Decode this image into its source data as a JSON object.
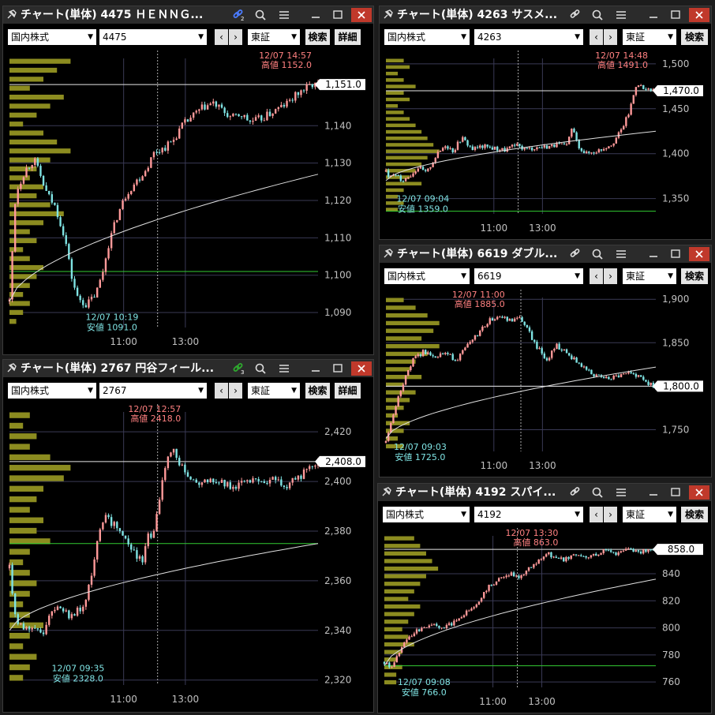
{
  "windows": [
    {
      "id": "w1",
      "title": "チャート(単体) 4475 ＨＥＮＮＧ...",
      "link_icon_color": "#4a7bff",
      "link_group": "2",
      "market_label": "国内株式",
      "code": "4475",
      "exchange": "東証",
      "search_label": "検索",
      "detail_label": "詳細",
      "chart_data": {
        "type": "candlestick",
        "ylim": [
          1086,
          1158
        ],
        "y_ticks": [
          "1,140",
          "1,130",
          "1,120",
          "1,110",
          "1,100",
          "1,090"
        ],
        "y_tick_values": [
          1140,
          1130,
          1120,
          1110,
          1100,
          1090
        ],
        "x_ticks": [
          "11:00",
          "13:00"
        ],
        "x_tick_positions": [
          0.37,
          0.57
        ],
        "lunch_break_position": 0.48,
        "current_price": 1151.0,
        "current_price_label": "1,151.0",
        "high": {
          "time": "12/07 14:57",
          "label": "高値 1152.0",
          "value": 1152.0,
          "position": 0.97
        },
        "low": {
          "time": "12/07 10:19",
          "label": "安値 1091.0",
          "value": 1091.0,
          "position": 0.23
        },
        "green_line": 1101,
        "vwap_start": 1093,
        "vwap_end": 1127,
        "path": [
          [
            0,
            1093
          ],
          [
            0.02,
            1122
          ],
          [
            0.05,
            1128
          ],
          [
            0.08,
            1131
          ],
          [
            0.12,
            1122
          ],
          [
            0.15,
            1118
          ],
          [
            0.18,
            1110
          ],
          [
            0.2,
            1100
          ],
          [
            0.22,
            1094
          ],
          [
            0.25,
            1092
          ],
          [
            0.28,
            1095
          ],
          [
            0.3,
            1100
          ],
          [
            0.32,
            1108
          ],
          [
            0.35,
            1116
          ],
          [
            0.38,
            1122
          ],
          [
            0.41,
            1125
          ],
          [
            0.44,
            1128
          ],
          [
            0.47,
            1133
          ],
          [
            0.5,
            1134
          ],
          [
            0.53,
            1136
          ],
          [
            0.56,
            1140
          ],
          [
            0.6,
            1143
          ],
          [
            0.63,
            1145
          ],
          [
            0.66,
            1146
          ],
          [
            0.69,
            1144
          ],
          [
            0.72,
            1142
          ],
          [
            0.75,
            1143
          ],
          [
            0.78,
            1141
          ],
          [
            0.82,
            1142
          ],
          [
            0.86,
            1144
          ],
          [
            0.9,
            1146
          ],
          [
            0.94,
            1149
          ],
          [
            0.98,
            1151
          ],
          [
            1,
            1151
          ]
        ],
        "profile": [
          0.9,
          0.7,
          0.5,
          0.3,
          0.8,
          0.6,
          0.4,
          0.2,
          0.5,
          0.7,
          0.9,
          0.6,
          0.4,
          0.3,
          0.5,
          0.4,
          0.6,
          0.8,
          0.5,
          0.3,
          0.4,
          0.2,
          0.3,
          0.5,
          0.4,
          0.3,
          0.2,
          0.3,
          0.2,
          0.1
        ]
      }
    },
    {
      "id": "w2",
      "title": "チャート(単体) 4263 サスメ...",
      "market_label": "国内株式",
      "code": "4263",
      "exchange": "東証",
      "search_label": "検索",
      "chart_data": {
        "type": "candlestick",
        "ylim": [
          1333,
          1506
        ],
        "y_ticks": [
          "1,500",
          "1,450",
          "1,400",
          "1,350"
        ],
        "y_tick_values": [
          1500,
          1450,
          1400,
          1350
        ],
        "x_ticks": [
          "11:00",
          "13:00"
        ],
        "x_tick_positions": [
          0.4,
          0.58
        ],
        "lunch_break_position": 0.49,
        "current_price": 1470.0,
        "current_price_label": "1,470.0",
        "high": {
          "time": "12/07 14:48",
          "label": "高値 1491.0",
          "value": 1491.0,
          "position": 0.93
        },
        "low": {
          "time": "12/07 09:04",
          "label": "安値 1359.0",
          "value": 1359.0,
          "position": 0.02
        },
        "green_line": 1336,
        "vwap_start": 1370,
        "vwap_end": 1425,
        "path": [
          [
            0,
            1380
          ],
          [
            0.02,
            1372
          ],
          [
            0.04,
            1378
          ],
          [
            0.06,
            1370
          ],
          [
            0.09,
            1376
          ],
          [
            0.12,
            1385
          ],
          [
            0.15,
            1378
          ],
          [
            0.18,
            1395
          ],
          [
            0.22,
            1410
          ],
          [
            0.25,
            1403
          ],
          [
            0.28,
            1418
          ],
          [
            0.32,
            1405
          ],
          [
            0.36,
            1408
          ],
          [
            0.4,
            1406
          ],
          [
            0.44,
            1404
          ],
          [
            0.48,
            1409
          ],
          [
            0.52,
            1405
          ],
          [
            0.56,
            1407
          ],
          [
            0.6,
            1408
          ],
          [
            0.64,
            1410
          ],
          [
            0.67,
            1408
          ],
          [
            0.69,
            1430
          ],
          [
            0.71,
            1410
          ],
          [
            0.74,
            1400
          ],
          [
            0.77,
            1402
          ],
          [
            0.8,
            1405
          ],
          [
            0.84,
            1412
          ],
          [
            0.87,
            1425
          ],
          [
            0.9,
            1445
          ],
          [
            0.93,
            1480
          ],
          [
            0.96,
            1470
          ],
          [
            1,
            1470
          ]
        ],
        "profile": [
          0.3,
          0.4,
          0.2,
          0.3,
          0.5,
          0.3,
          0.4,
          0.2,
          0.3,
          0.4,
          0.5,
          0.6,
          0.7,
          0.8,
          0.9,
          0.7,
          0.6,
          0.5,
          0.4,
          0.6,
          0.3,
          0.2,
          0.3,
          0.2
        ]
      }
    },
    {
      "id": "w3",
      "title": "チャート(単体) 6619 ダブル...",
      "market_label": "国内株式",
      "code": "6619",
      "exchange": "東証",
      "search_label": "検索",
      "chart_data": {
        "type": "candlestick",
        "ylim": [
          1725,
          1902
        ],
        "y_ticks": [
          "1,900",
          "1,850",
          "1,800",
          "1,750"
        ],
        "y_tick_values": [
          1900,
          1850,
          1800,
          1750
        ],
        "x_ticks": [
          "11:00",
          "13:00"
        ],
        "x_tick_positions": [
          0.4,
          0.58
        ],
        "lunch_break_position": 0.5,
        "current_price": 1800.0,
        "current_price_label": "1,800.0",
        "high": {
          "time": "12/07 11:00",
          "label": "高値 1885.0",
          "value": 1885.0,
          "position": 0.4
        },
        "low": {
          "time": "12/07 09:03",
          "label": "安値 1725.0",
          "value": 1725.0,
          "position": 0.01
        },
        "green_line": null,
        "vwap_start": 1740,
        "vwap_end": 1822,
        "path": [
          [
            0,
            1735
          ],
          [
            0.03,
            1770
          ],
          [
            0.06,
            1800
          ],
          [
            0.1,
            1830
          ],
          [
            0.14,
            1840
          ],
          [
            0.18,
            1835
          ],
          [
            0.22,
            1838
          ],
          [
            0.26,
            1830
          ],
          [
            0.3,
            1845
          ],
          [
            0.34,
            1860
          ],
          [
            0.38,
            1875
          ],
          [
            0.42,
            1880
          ],
          [
            0.46,
            1875
          ],
          [
            0.5,
            1878
          ],
          [
            0.53,
            1862
          ],
          [
            0.56,
            1845
          ],
          [
            0.6,
            1830
          ],
          [
            0.63,
            1848
          ],
          [
            0.66,
            1840
          ],
          [
            0.7,
            1830
          ],
          [
            0.74,
            1820
          ],
          [
            0.78,
            1812
          ],
          [
            0.82,
            1808
          ],
          [
            0.86,
            1812
          ],
          [
            0.9,
            1815
          ],
          [
            0.94,
            1810
          ],
          [
            0.97,
            1803
          ],
          [
            1,
            1800
          ]
        ],
        "profile": [
          0.3,
          0.5,
          0.7,
          0.9,
          0.8,
          0.6,
          0.9,
          0.7,
          0.5,
          0.4,
          0.6,
          0.3,
          0.5,
          0.4,
          0.3,
          0.2,
          0.4,
          0.3,
          0.2,
          0.3
        ]
      }
    },
    {
      "id": "w4",
      "title": "チャート(単体) 2767 円谷フィール...",
      "link_icon_color": "#2ea82e",
      "link_group": "3",
      "market_label": "国内株式",
      "code": "2767",
      "exchange": "東証",
      "search_label": "検索",
      "detail_label": "詳細",
      "chart_data": {
        "type": "candlestick",
        "ylim": [
          2318,
          2428
        ],
        "y_ticks": [
          "2,420",
          "2,400",
          "2,380",
          "2,360",
          "2,340",
          "2,320"
        ],
        "y_tick_values": [
          2420,
          2400,
          2380,
          2360,
          2340,
          2320
        ],
        "x_ticks": [
          "11:00",
          "13:00"
        ],
        "x_tick_positions": [
          0.37,
          0.57
        ],
        "lunch_break_position": 0.48,
        "current_price": 2408.0,
        "current_price_label": "2,408.0",
        "high": {
          "time": "12/07 12:57",
          "label": "高値 2418.0",
          "value": 2418.0,
          "position": 0.52
        },
        "low": {
          "time": "12/07 09:35",
          "label": "安値 2328.0",
          "value": 2328.0,
          "position": 0.12
        },
        "green_line": 2375,
        "vwap_start": 2340,
        "vwap_end": 2375,
        "path": [
          [
            0,
            2365
          ],
          [
            0.02,
            2345
          ],
          [
            0.05,
            2340
          ],
          [
            0.08,
            2342
          ],
          [
            0.11,
            2338
          ],
          [
            0.13,
            2348
          ],
          [
            0.16,
            2350
          ],
          [
            0.2,
            2345
          ],
          [
            0.24,
            2350
          ],
          [
            0.27,
            2365
          ],
          [
            0.29,
            2378
          ],
          [
            0.31,
            2385
          ],
          [
            0.34,
            2383
          ],
          [
            0.37,
            2378
          ],
          [
            0.4,
            2372
          ],
          [
            0.43,
            2368
          ],
          [
            0.45,
            2378
          ],
          [
            0.47,
            2380
          ],
          [
            0.49,
            2395
          ],
          [
            0.51,
            2410
          ],
          [
            0.53,
            2415
          ],
          [
            0.55,
            2408
          ],
          [
            0.58,
            2402
          ],
          [
            0.62,
            2400
          ],
          [
            0.66,
            2401
          ],
          [
            0.7,
            2399
          ],
          [
            0.74,
            2398
          ],
          [
            0.78,
            2400
          ],
          [
            0.82,
            2399
          ],
          [
            0.86,
            2401
          ],
          [
            0.9,
            2398
          ],
          [
            0.94,
            2402
          ],
          [
            0.97,
            2406
          ],
          [
            1,
            2408
          ]
        ],
        "profile": [
          0.3,
          0.2,
          0.4,
          0.3,
          0.6,
          0.9,
          0.8,
          0.5,
          0.4,
          0.3,
          0.5,
          0.4,
          0.6,
          0.3,
          0.2,
          0.3,
          0.4,
          0.3,
          0.2,
          0.3,
          0.5,
          0.3,
          0.2,
          0.4,
          0.3,
          0.2
        ]
      }
    },
    {
      "id": "w5",
      "title": "チャート(単体) 4192 スパイ...",
      "market_label": "国内株式",
      "code": "4192",
      "exchange": "東証",
      "search_label": "検索",
      "chart_data": {
        "type": "candlestick",
        "ylim": [
          756,
          868
        ],
        "y_ticks": [
          "840",
          "820",
          "800",
          "780",
          "760"
        ],
        "y_tick_values": [
          840,
          820,
          800,
          780,
          760
        ],
        "x_ticks": [
          "11:00",
          "13:00"
        ],
        "x_tick_positions": [
          0.4,
          0.58
        ],
        "lunch_break_position": 0.49,
        "current_price": 858.0,
        "current_price_label": "858.0",
        "high": {
          "time": "12/07 13:30",
          "label": "高値 863.0",
          "value": 863.0,
          "position": 0.6
        },
        "low": {
          "time": "12/07 09:08",
          "label": "安値 766.0",
          "value": 766.0,
          "position": 0.03
        },
        "green_line": 772,
        "vwap_start": 772,
        "vwap_end": 836,
        "path": [
          [
            0,
            775
          ],
          [
            0.03,
            770
          ],
          [
            0.06,
            785
          ],
          [
            0.1,
            795
          ],
          [
            0.14,
            800
          ],
          [
            0.18,
            803
          ],
          [
            0.22,
            800
          ],
          [
            0.26,
            805
          ],
          [
            0.3,
            812
          ],
          [
            0.34,
            818
          ],
          [
            0.38,
            830
          ],
          [
            0.42,
            835
          ],
          [
            0.46,
            840
          ],
          [
            0.5,
            838
          ],
          [
            0.53,
            845
          ],
          [
            0.56,
            848
          ],
          [
            0.6,
            855
          ],
          [
            0.63,
            852
          ],
          [
            0.66,
            850
          ],
          [
            0.7,
            855
          ],
          [
            0.74,
            852
          ],
          [
            0.78,
            855
          ],
          [
            0.82,
            857
          ],
          [
            0.86,
            855
          ],
          [
            0.9,
            858
          ],
          [
            0.94,
            856
          ],
          [
            1,
            858
          ]
        ],
        "profile": [
          0.5,
          0.6,
          0.7,
          0.8,
          0.9,
          0.7,
          0.6,
          0.5,
          0.4,
          0.6,
          0.5,
          0.4,
          0.3,
          0.4,
          0.5,
          0.3,
          0.2,
          0.3,
          0.2,
          0.2
        ]
      }
    }
  ],
  "colors": {
    "up": "#ff9999",
    "down": "#7fe3e3",
    "profile": "#8c8c20",
    "green_line": "#33cc33",
    "high_text": "#ff8080",
    "low_text": "#7fe3e3",
    "axis_text": "#c0c0c0",
    "grid": "#3a3a55"
  }
}
